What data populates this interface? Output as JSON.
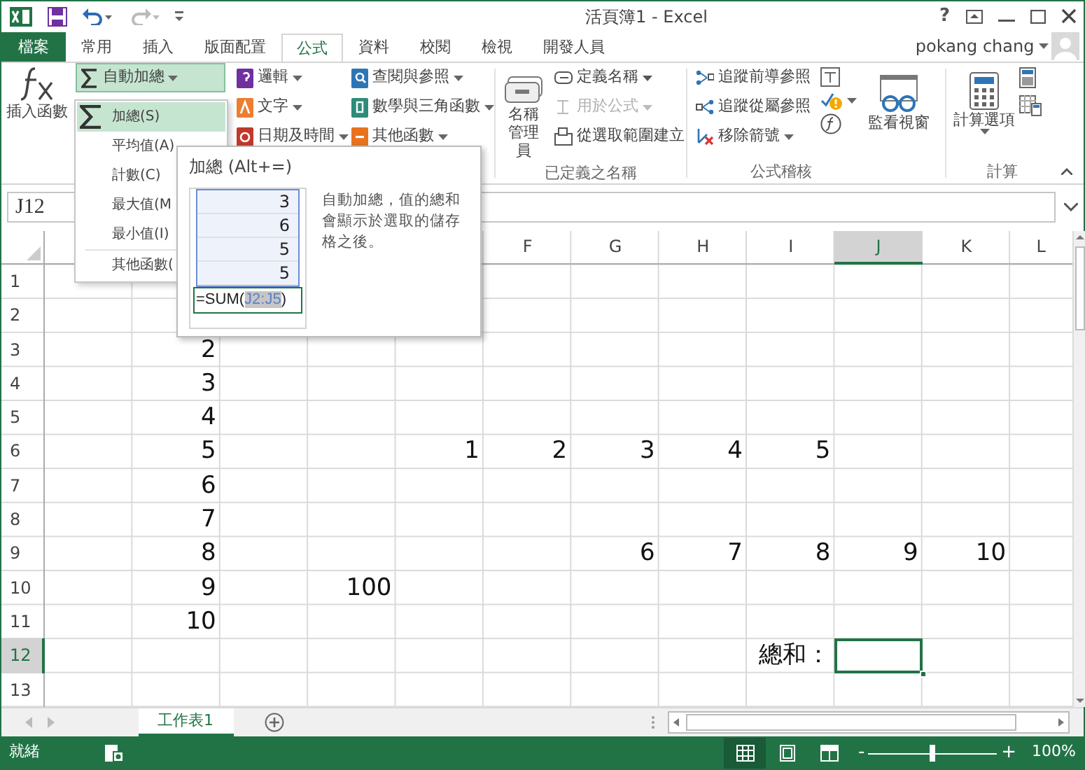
{
  "window": {
    "title": "活頁簿1 - Excel",
    "help": "?"
  },
  "tabs": [
    {
      "label": "檔案",
      "kind": "file",
      "selected": false
    },
    {
      "label": "常用",
      "kind": "tab",
      "selected": false
    },
    {
      "label": "插入",
      "kind": "tab",
      "selected": false
    },
    {
      "label": "版面配置",
      "kind": "tab",
      "selected": false
    },
    {
      "label": "公式",
      "kind": "tab",
      "selected": true
    },
    {
      "label": "資料",
      "kind": "tab",
      "selected": false
    },
    {
      "label": "校閱",
      "kind": "tab",
      "selected": false
    },
    {
      "label": "檢視",
      "kind": "tab",
      "selected": false
    },
    {
      "label": "開發人員",
      "kind": "tab",
      "selected": false
    }
  ],
  "user": {
    "name": "pokang chang"
  },
  "function_library": {
    "insert_function": "插入函數",
    "autosum": {
      "label": "自動加總",
      "pressed": true
    },
    "buttons": [
      {
        "label": "邏輯",
        "kind": "logic"
      },
      {
        "label": "文字",
        "kind": "text"
      },
      {
        "label": "日期及時間",
        "kind": "date"
      },
      {
        "label": "查閱與參照",
        "kind": "lookup"
      },
      {
        "label": "數學與三角函數",
        "kind": "math"
      },
      {
        "label": "其他函數",
        "kind": "more"
      }
    ]
  },
  "defined_names": {
    "label": "已定義之名稱",
    "manager": [
      "名稱",
      "管理員"
    ],
    "items": [
      {
        "label": "定義名稱",
        "kind": "define",
        "disabled": false,
        "dropdown": true
      },
      {
        "label": "用於公式",
        "kind": "use",
        "disabled": true,
        "dropdown": true
      },
      {
        "label": "從選取範圍建立",
        "kind": "create",
        "disabled": false,
        "dropdown": false
      }
    ]
  },
  "formula_auditing": {
    "label": "公式稽核",
    "watch": "監看視窗",
    "items": [
      {
        "label": "追蹤前導參照",
        "kind": "precedents",
        "dropdown": false
      },
      {
        "label": "追蹤從屬參照",
        "kind": "dependents",
        "dropdown": false
      },
      {
        "label": "移除箭號",
        "kind": "remove",
        "dropdown": true
      }
    ]
  },
  "calculation": {
    "label": "計算",
    "options": "計算選項"
  },
  "autosum_menu": [
    {
      "label": "加總(S)",
      "kind": "sum",
      "selected": true
    },
    {
      "label": "平均值(A)",
      "kind": "plain",
      "selected": false
    },
    {
      "label": "計數(C)",
      "kind": "plain",
      "selected": false
    },
    {
      "label": "最大值(M",
      "kind": "plain",
      "selected": false
    },
    {
      "label": "最小值(I)",
      "kind": "plain",
      "selected": false
    },
    {
      "label": "其他函數(",
      "kind": "plain",
      "selected": false
    }
  ],
  "tooltip": {
    "title": "加總 (Alt+=)",
    "preview_values": [
      "3",
      "6",
      "5",
      "5"
    ],
    "formula_start": "=SUM(",
    "formula_ref": "J2:J5",
    "formula_end": ")",
    "description": "自動加總，值的總和會顯示於選取的儲存格之後。"
  },
  "formula_bar": {
    "name_box": "J12"
  },
  "sheet": {
    "columns": [
      {
        "label": "F",
        "selected": false
      },
      {
        "label": "G",
        "selected": false
      },
      {
        "label": "H",
        "selected": false
      },
      {
        "label": "I",
        "selected": false
      },
      {
        "label": "J",
        "selected": true
      },
      {
        "label": "K",
        "selected": false
      },
      {
        "label": "L",
        "selected": false
      }
    ],
    "rows": [
      {
        "label": "1",
        "selected": false,
        "cells": [
          null,
          null,
          null,
          null,
          null,
          null,
          null,
          null,
          null,
          null,
          null,
          null
        ]
      },
      {
        "label": "2",
        "selected": false,
        "cells": [
          null,
          null,
          null,
          null,
          null,
          null,
          null,
          null,
          null,
          null,
          null,
          null
        ]
      },
      {
        "label": "3",
        "selected": false,
        "cells": [
          null,
          "2",
          null,
          null,
          null,
          null,
          null,
          null,
          null,
          null,
          null,
          null
        ]
      },
      {
        "label": "4",
        "selected": false,
        "cells": [
          null,
          "3",
          null,
          null,
          null,
          null,
          null,
          null,
          null,
          null,
          null,
          null
        ]
      },
      {
        "label": "5",
        "selected": false,
        "cells": [
          null,
          "4",
          null,
          null,
          null,
          null,
          null,
          null,
          null,
          null,
          null,
          null
        ]
      },
      {
        "label": "6",
        "selected": false,
        "cells": [
          null,
          "5",
          null,
          null,
          "1",
          "2",
          "3",
          "4",
          "5",
          null,
          null,
          null
        ]
      },
      {
        "label": "7",
        "selected": false,
        "cells": [
          null,
          "6",
          null,
          null,
          null,
          null,
          null,
          null,
          null,
          null,
          null,
          null
        ]
      },
      {
        "label": "8",
        "selected": false,
        "cells": [
          null,
          "7",
          null,
          null,
          null,
          null,
          null,
          null,
          null,
          null,
          null,
          null
        ]
      },
      {
        "label": "9",
        "selected": false,
        "cells": [
          null,
          "8",
          null,
          null,
          null,
          null,
          "6",
          "7",
          "8",
          "9",
          "10",
          null
        ]
      },
      {
        "label": "10",
        "selected": false,
        "cells": [
          null,
          "9",
          null,
          "100",
          null,
          null,
          null,
          null,
          null,
          null,
          null,
          null
        ]
      },
      {
        "label": "11",
        "selected": false,
        "cells": [
          null,
          "10",
          null,
          null,
          null,
          null,
          null,
          null,
          null,
          null,
          null,
          null
        ]
      },
      {
        "label": "12",
        "selected": true,
        "cells": [
          null,
          null,
          null,
          null,
          null,
          null,
          null,
          null,
          "總和：",
          null,
          null,
          null
        ]
      },
      {
        "label": "13",
        "selected": false,
        "cells": [
          null,
          null,
          null,
          null,
          null,
          null,
          null,
          null,
          null,
          null,
          null,
          null
        ]
      }
    ]
  },
  "sheet_tabs": [
    {
      "label": "工作表1",
      "selected": true
    }
  ],
  "status_bar": {
    "status": "就緒",
    "views": [
      {
        "kind": "normal",
        "selected": true
      },
      {
        "kind": "page_layout",
        "selected": false
      },
      {
        "kind": "page_break",
        "selected": false
      }
    ],
    "zoom": {
      "minus": "-",
      "plus": "+",
      "level": 0.5,
      "reading": "100%"
    }
  }
}
